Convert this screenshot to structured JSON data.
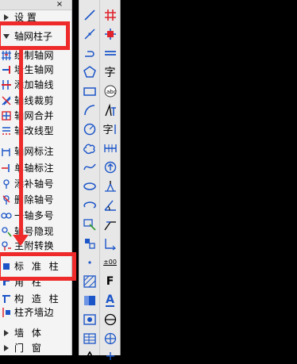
{
  "panel": {
    "close_label": "×",
    "items": [
      {
        "label": "设    置",
        "icon": "triangle-right-icon"
      },
      {
        "label": "轴网柱子",
        "icon": "triangle-down-icon"
      },
      {
        "label": "绘制轴网",
        "icon": "grid-draw-icon"
      },
      {
        "label": "墙生轴网",
        "icon": "wall-grid-icon"
      },
      {
        "label": "添加轴线",
        "icon": "add-axis-icon"
      },
      {
        "label": "轴线裁剪",
        "icon": "axis-trim-icon"
      },
      {
        "label": "轴网合并",
        "icon": "grid-merge-icon"
      },
      {
        "label": "轴改线型",
        "icon": "axis-linetype-icon"
      },
      {
        "label": "轴网标注",
        "icon": "grid-dim-icon"
      },
      {
        "label": "单轴标注",
        "icon": "single-axis-dim-icon"
      },
      {
        "label": "添补轴号",
        "icon": "add-axis-number-icon"
      },
      {
        "label": "删除轴号",
        "icon": "delete-axis-number-icon"
      },
      {
        "label": "一轴多号",
        "icon": "multi-number-icon"
      },
      {
        "label": "轴号隐现",
        "icon": "toggle-axis-number-icon"
      },
      {
        "label": "主附转换",
        "icon": "convert-icon"
      },
      {
        "label": "标 准 柱",
        "icon": "standard-column-icon"
      },
      {
        "label": "角    柱",
        "icon": "corner-column-icon"
      },
      {
        "label": "构 造 柱",
        "icon": "structural-column-icon"
      },
      {
        "label": "柱齐墙边",
        "icon": "align-column-icon"
      },
      {
        "label": "墙    体",
        "icon": "triangle-right-icon"
      },
      {
        "label": "门    窗",
        "icon": "triangle-right-icon"
      }
    ]
  },
  "toolbar_left": [
    "line-icon",
    "polyline-icon",
    "arc-polyline-icon",
    "polygon-icon",
    "rectangle-icon",
    "arc-icon",
    "circle-icon",
    "revcloud-icon",
    "spline-icon",
    "ellipse-icon",
    "ellipse-arc-icon",
    "insert-block-icon",
    "make-block-icon",
    "point-icon",
    "hatch-icon",
    "gradient-icon",
    "region-icon",
    "table-icon",
    "mtext-icon"
  ],
  "toolbar_right": [
    "axis-symbol-icon",
    "column-symbol-icon",
    "double-line-icon",
    "text-icon",
    "spell-check-icon",
    "text-style-icon",
    "text-align-icon",
    "dimension-icon",
    "arrow-icon",
    "elevation-icon",
    "angle-icon",
    "leader-icon",
    "elevation-mark-icon",
    "f-mark-icon",
    "text-a-icon",
    "index-icon",
    "compass-icon",
    "node-icon",
    "section-icon"
  ],
  "toolbar_right_text": {
    "text": "字",
    "text_style": "字",
    "text_a": "A",
    "dim_f": "F",
    "elev": "±00"
  },
  "colors": {
    "highlight": "#ee2a2a",
    "panel_bg": "#f4f4f4",
    "toolbar_bg": "#e7e7e7",
    "icon_blue": "#1b55c8",
    "icon_red": "#e0232b"
  }
}
